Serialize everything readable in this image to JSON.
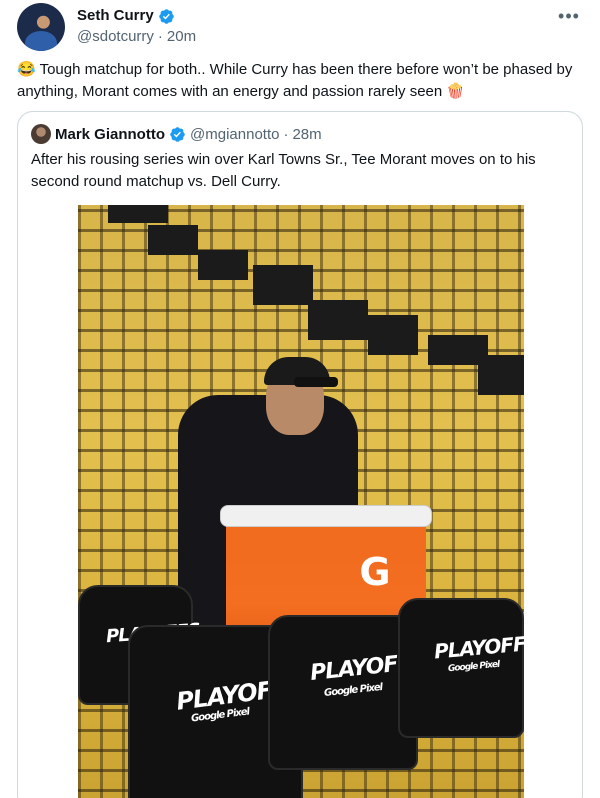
{
  "author": {
    "display_name": "Seth Curry",
    "handle": "@sdotcurry",
    "separator": "·",
    "time": "20m",
    "verified_icon": "verified-badge-icon",
    "more_icon": "more-dots-icon"
  },
  "tweet": {
    "text": "😂 Tough matchup for both.. While Curry has been there before won’t be phased by anything, Morant comes with an energy and passion rarely seen 🍿"
  },
  "quote": {
    "display_name": "Mark Giannotto",
    "handle": "@mgiannotto",
    "separator": "·",
    "time": "28m",
    "text": "After his rousing series win over Karl Towns Sr., Tee Morant moves on to his second round matchup vs. Dell Curry."
  },
  "photo": {
    "chair_text": "PLAYOFFS",
    "chair_subtext": "Google Pixel"
  },
  "colors": {
    "verified": "#1d9bf0",
    "secondary_text": "#536471",
    "border": "#cfd9de"
  }
}
